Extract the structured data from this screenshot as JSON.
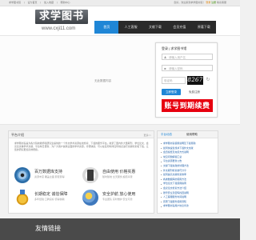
{
  "topbar": {
    "left_links": [
      "求学图书馆",
      "|",
      "设为首页",
      "|",
      "加入收藏",
      "|",
      "帮助中心"
    ],
    "right_text": [
      "您好，欢迎来到求学图书馆！",
      "登录",
      "注册",
      "联系客服"
    ]
  },
  "logo": {
    "text": "求学图书馆",
    "url": "www.cxji11.com"
  },
  "nav": [
    "首页",
    "人工客服",
    "文献下载",
    "会员充值",
    "原著下载"
  ],
  "banner": {
    "notice": "无此数据内容"
  },
  "login": {
    "title": "登录 | 求学图书馆",
    "username_placeholder": "请输入用户名",
    "password_placeholder": "请输入密码",
    "captcha_placeholder": "验证码",
    "captcha_code": "8267",
    "refresh_icon": "refresh-icon",
    "login_button": "立即登录",
    "register_button": "免费注册",
    "renew_banner": "账号到期续费"
  },
  "platform": {
    "title": "平台介绍",
    "more": "更多>>",
    "description": "求学图书馆是为各大院校教师和研究生提供的一个外文学术资源在线检索、下载的服务平台。收录了国内外大量期刊、学位论文、会议论文等学术文献，平台每日更新，为广大用户提供全面的学术资源。方便快捷，可以在任何时间任何地点进行文献检索和下载，让您的研究更加高效便捷。",
    "features": [
      {
        "icon": "database-disc-icon",
        "title": "百万数据库支持",
        "desc": "资源丰富 覆盖全面 即查即得"
      },
      {
        "icon": "mobile-phone-icon",
        "title": "自由使用 价格实惠",
        "desc": "随时随地 全天服务 超值享受"
      },
      {
        "icon": "medal-icon",
        "title": "长期稳定 诚信保障",
        "desc": "多年经验 口碑良好 值得信赖"
      },
      {
        "icon": "shield-icon",
        "title": "安全护航 放心使用",
        "desc": "专业团队 实时维护 安全可靠"
      }
    ]
  },
  "news": {
    "tabs": [
      "平台动态",
      "使用帮助"
    ],
    "items": [
      "求学图书馆使用说明及下载帮助",
      "如何快速查找并下载外文文献",
      "会员续费及充值方式说明",
      "常见问题解答汇总",
      "平台资源更新公告",
      "文献下载失败的处理方法",
      "外文期刊检索技巧分享",
      "如何提高文献检索效率",
      "各类数据库的使用方法",
      "学位论文下载使用指南",
      "会议论文检索方法介绍",
      "账号安全及密码找回说明",
      "人工客服服务时间说明",
      "原著下载服务使用须知",
      "求学图书馆用户协议条款"
    ]
  },
  "footer": {
    "friends_title": "友情链接"
  }
}
